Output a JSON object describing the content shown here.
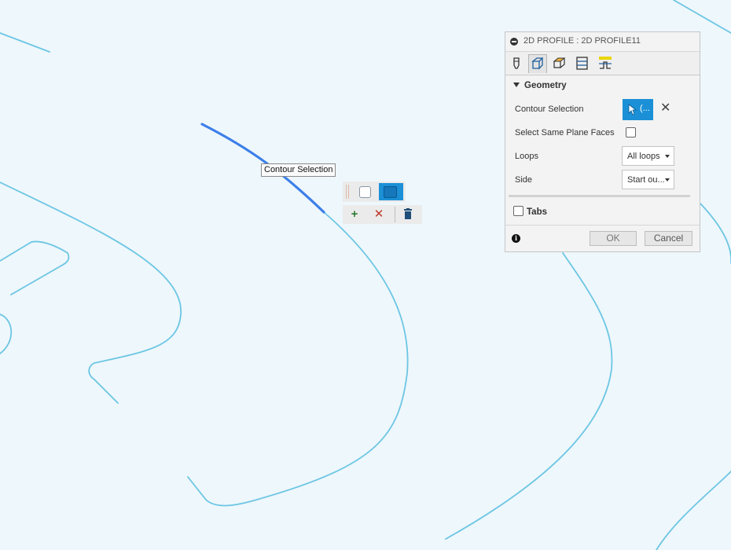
{
  "canvas": {
    "tooltip": "Contour Selection",
    "colors": {
      "background": "#eef7fc",
      "curve": "#6cc6e3",
      "selected_curve": "#3c7fe9"
    }
  },
  "mini_toolbar": {
    "icons": [
      "grip-icon",
      "checkbox-icon",
      "selection-filter-icon",
      "add-icon",
      "remove-icon",
      "delete-icon"
    ]
  },
  "panel": {
    "title": "2D PROFILE : 2D PROFILE11",
    "tabs": [
      "tool-tab-icon",
      "geometry-tab-icon",
      "heights-tab-icon",
      "passes-tab-icon",
      "linking-tab-icon"
    ],
    "geometry": {
      "section_label": "Geometry",
      "contour_selection_label": "Contour Selection",
      "contour_selection_value": "(...",
      "same_plane_label": "Select Same Plane Faces",
      "loops_label": "Loops",
      "loops_value": "All loops",
      "side_label": "Side",
      "side_value": "Start ou..."
    },
    "tabs_section": {
      "label": "Tabs"
    },
    "footer": {
      "ok": "OK",
      "cancel": "Cancel"
    },
    "colors": {
      "accent": "#1b90d6"
    }
  }
}
